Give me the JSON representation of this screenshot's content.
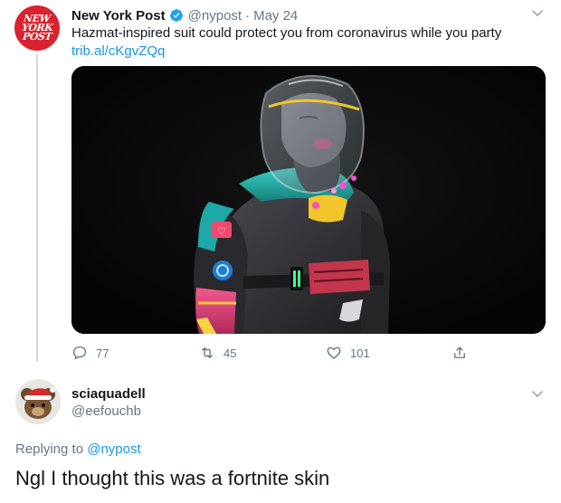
{
  "original_tweet": {
    "author": {
      "display_name": "New York Post",
      "handle": "@nypost",
      "verified": true,
      "avatar_text": [
        "NEW",
        "YORK",
        "POST"
      ]
    },
    "separator": "·",
    "date": "May 24",
    "text": "Hazmat-inspired suit could protect you from coronavirus while you party",
    "link": "trib.al/cKgvZQq",
    "media": {
      "icon": "hazmat-suit-render-image"
    },
    "actions": {
      "replies": "77",
      "retweets": "45",
      "likes": "101"
    }
  },
  "reply_tweet": {
    "author": {
      "display_name": "sciaquadell",
      "handle": "@eefouchb"
    },
    "replying_to_prefix": "Replying to",
    "replying_to_handle": "@nypost",
    "text": "Ngl I thought this was a fortnite skin"
  },
  "colors": {
    "link": "#1b95e0",
    "muted": "#657786",
    "nypost_red": "#d9232e",
    "thread_line": "#cfd9de"
  }
}
